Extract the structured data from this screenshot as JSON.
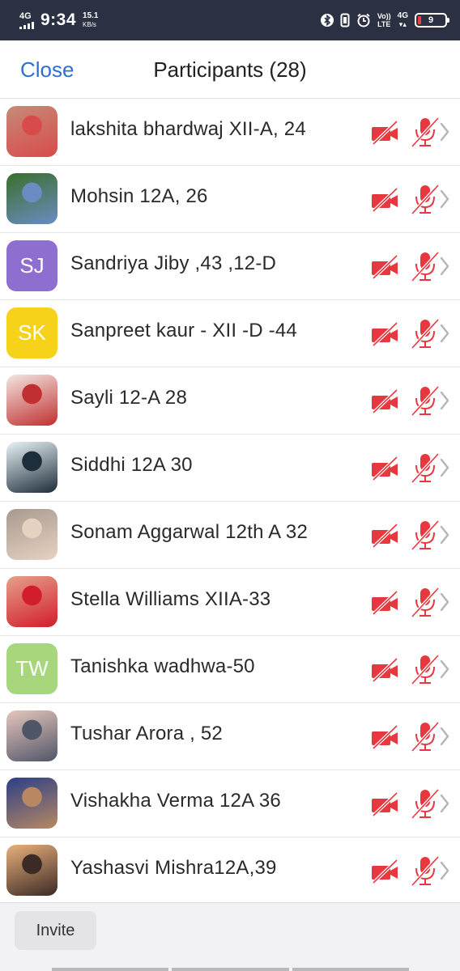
{
  "status_bar": {
    "network": "4G",
    "time": "9:34",
    "speed": "15.1",
    "speed_unit": "KB/s",
    "volte_top": "Vo))",
    "volte_bottom": "LTE",
    "net2": "4G",
    "battery": "9",
    "icons": [
      "bluetooth-icon",
      "vibrate-icon",
      "alarm-icon"
    ]
  },
  "header": {
    "close_label": "Close",
    "title": "Participants (28)"
  },
  "participants": [
    {
      "name": "lakshita bhardwaj XII-A, 24",
      "avatar_type": "photo",
      "photo_colors": [
        "#c58b78",
        "#d94a4a"
      ]
    },
    {
      "name": "Mohsin 12A, 26",
      "avatar_type": "photo",
      "photo_colors": [
        "#3a6e2c",
        "#6b8cc2"
      ]
    },
    {
      "name": "Sandriya Jiby ,43 ,12-D",
      "avatar_type": "initials",
      "initials": "SJ",
      "color": "#8e6fcf"
    },
    {
      "name": "Sanpreet kaur - XII -D -44",
      "avatar_type": "initials",
      "initials": "SK",
      "color": "#f7d21a"
    },
    {
      "name": "Sayli 12-A 28",
      "avatar_type": "photo",
      "photo_colors": [
        "#f3e6e0",
        "#c03030"
      ]
    },
    {
      "name": "Siddhi 12A 30",
      "avatar_type": "photo",
      "photo_colors": [
        "#e9f3f7",
        "#1d2d3a"
      ]
    },
    {
      "name": "Sonam Aggarwal  12th A  32",
      "avatar_type": "photo",
      "photo_colors": [
        "#a79a8e",
        "#e7d2c2"
      ]
    },
    {
      "name": "Stella Williams XIIA-33",
      "avatar_type": "photo",
      "photo_colors": [
        "#e5a08c",
        "#d21d2a"
      ]
    },
    {
      "name": "Tanishka wadhwa-50",
      "avatar_type": "initials",
      "initials": "TW",
      "color": "#a8d67d"
    },
    {
      "name": "Tushar Arora , 52",
      "avatar_type": "photo",
      "photo_colors": [
        "#e7c6bd",
        "#4f5668"
      ]
    },
    {
      "name": "Vishakha Verma 12A 36",
      "avatar_type": "photo",
      "photo_colors": [
        "#2b3f86",
        "#b88863"
      ]
    },
    {
      "name": "Yashasvi Mishra12A,39",
      "avatar_type": "photo",
      "photo_colors": [
        "#e9b07b",
        "#3b2a26"
      ]
    }
  ],
  "row_icons": {
    "video": "video-off-icon",
    "audio": "mic-muted-icon",
    "more": "chevron-right-icon",
    "muted_color": "#e8383f",
    "chevron_color": "#b5b5b5"
  },
  "footer": {
    "invite_label": "Invite"
  },
  "colors": {
    "accent": "#2f6fd0",
    "status_bar_bg": "#2b3042"
  }
}
